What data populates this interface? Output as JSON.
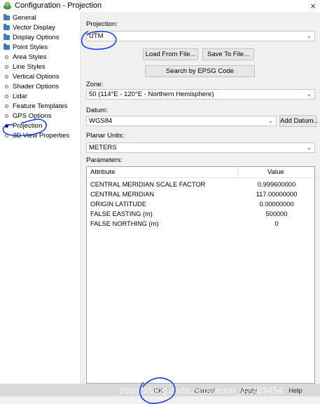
{
  "window": {
    "title": "Configuration - Projection",
    "close_glyph": "×"
  },
  "sidebar": {
    "items": [
      {
        "label": "General",
        "icon": "folder-icon"
      },
      {
        "label": "Vector Display",
        "icon": "folder-icon"
      },
      {
        "label": "Display Options",
        "icon": "folder-icon"
      },
      {
        "label": "Point Styles",
        "icon": "folder-icon"
      },
      {
        "label": "Area Styles",
        "icon": "bullet-icon"
      },
      {
        "label": "Line Styles",
        "icon": "bullet-icon"
      },
      {
        "label": "Vertical Options",
        "icon": "bullet-icon"
      },
      {
        "label": "Shader Options",
        "icon": "bullet-icon"
      },
      {
        "label": "Lidar",
        "icon": "bullet-icon"
      },
      {
        "label": "Feature Templates",
        "icon": "bullet-icon"
      },
      {
        "label": "GPS Options",
        "icon": "bullet-icon"
      },
      {
        "label": "Projection",
        "icon": "selected-bullet-icon",
        "selected": true
      },
      {
        "label": "3D View Properties",
        "icon": "bullet-icon"
      }
    ]
  },
  "main": {
    "projection_label": "Projection:",
    "projection_value": "UTM",
    "load_button": "Load From File...",
    "save_button": "Save To File...",
    "epsg_button": "Search by EPSG Code",
    "zone_label": "Zone:",
    "zone_value": "50 (114°E - 120°E - Northern Hemisphere)",
    "datum_label": "Datum:",
    "datum_value": "WGS84",
    "add_datum_button": "Add Datum...",
    "units_label": "Planar Units:",
    "units_value": "METERS",
    "parameters_label": "Parameters:",
    "table": {
      "headers": [
        "Attribute",
        "Value"
      ],
      "rows": [
        [
          "CENTRAL MERIDIAN SCALE FACTOR",
          "0.999600000"
        ],
        [
          "CENTRAL MERIDIAN",
          "117.00000000"
        ],
        [
          "ORIGIN LATITUDE",
          "0.00000000"
        ],
        [
          "FALSE EASTING (m)",
          "500000"
        ],
        [
          "FALSE NORTHING (m)",
          "0"
        ]
      ]
    }
  },
  "footer": {
    "ok_button": "OK",
    "cancel_button": "Cancel",
    "apply_button": "Apply",
    "help_button": "Help",
    "watermark": "https://blog.csdn.net/weixin_42463454"
  },
  "colors": {
    "annotation": "#1a3cff",
    "folder": "#3b7bbf"
  }
}
